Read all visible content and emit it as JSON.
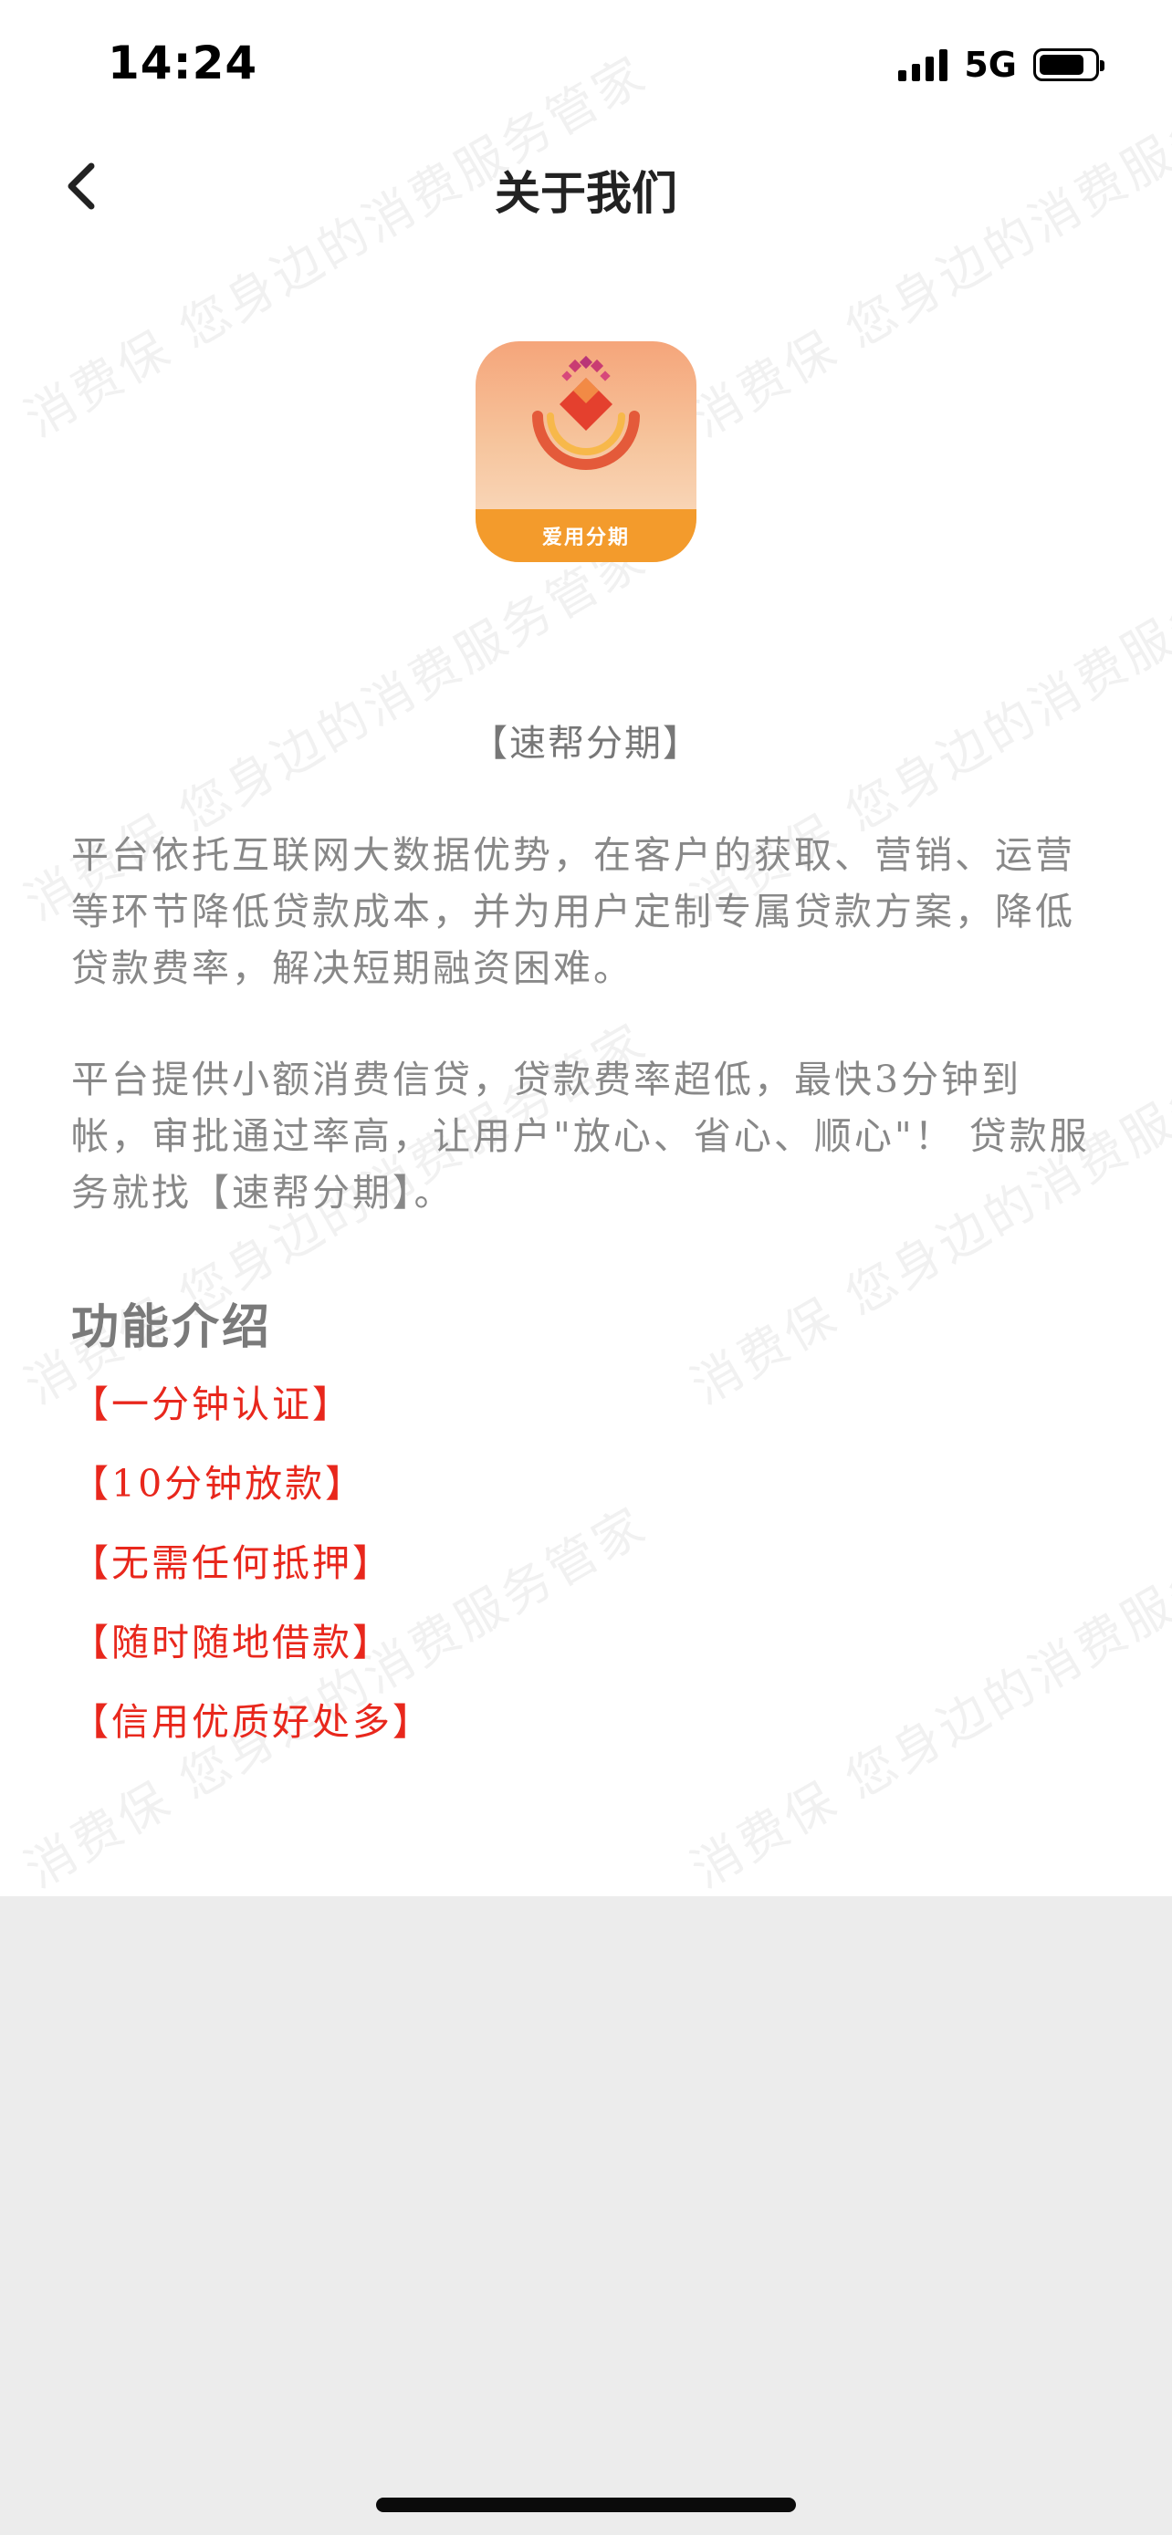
{
  "status_bar": {
    "time": "14:24",
    "network": "5G"
  },
  "nav": {
    "title": "关于我们"
  },
  "app": {
    "icon_label": "爱用分期",
    "name": "【速帮分期】"
  },
  "paragraphs": [
    "平台依托互联网大数据优势，在客户的获取、营销、运营等环节降低贷款成本，并为用户定制专属贷款方案，降低贷款费率，解决短期融资困难。",
    "平台提供小额消费信贷，贷款费率超低，最快3分钟到帐，审批通过率高，让用户\"放心、省心、顺心\"！ 贷款服务就找【速帮分期】。"
  ],
  "features": {
    "title": "功能介绍",
    "items": [
      "【一分钟认证】",
      "【10分钟放款】",
      "【无需任何抵押】",
      "【随时随地借款】",
      "【信用优质好处多】"
    ]
  },
  "watermark": {
    "text": "消费保 您身边的消费服务管家"
  },
  "colors": {
    "feature_red": "#e8271c",
    "body_gray": "#888888",
    "icon_orange": "#f39b2c"
  }
}
